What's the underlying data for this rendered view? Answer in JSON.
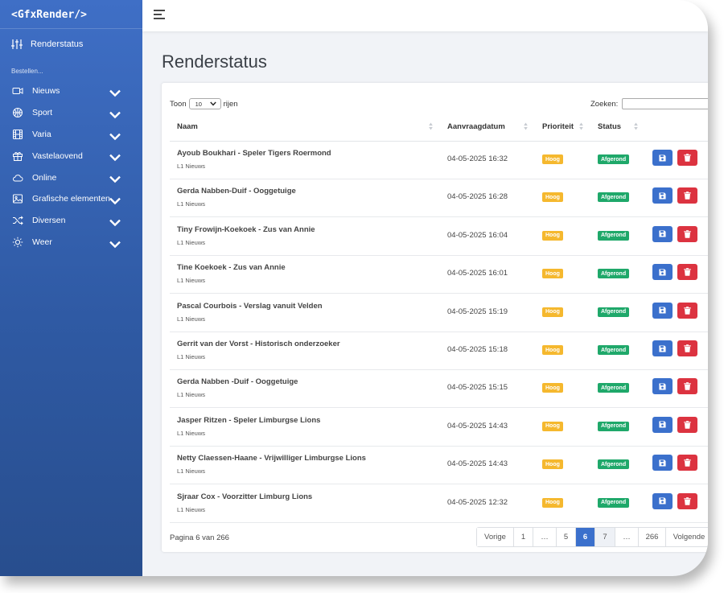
{
  "brand": "<GfxRender/>",
  "sidebar": {
    "main_item": "Renderstatus",
    "section_label": "Bestellen...",
    "items": [
      {
        "label": "Nieuws",
        "icon": "video-camera-icon"
      },
      {
        "label": "Sport",
        "icon": "ball-icon"
      },
      {
        "label": "Varia",
        "icon": "film-icon"
      },
      {
        "label": "Vastelaovend",
        "icon": "gift-icon"
      },
      {
        "label": "Online",
        "icon": "cloud-icon"
      },
      {
        "label": "Grafische elementen",
        "icon": "image-icon"
      },
      {
        "label": "Diversen",
        "icon": "shuffle-icon"
      },
      {
        "label": "Weer",
        "icon": "sun-icon"
      }
    ]
  },
  "page": {
    "title": "Renderstatus"
  },
  "table_controls": {
    "show_prefix": "Toon",
    "show_value": "10",
    "show_suffix": "rijen",
    "search_label": "Zoeken:"
  },
  "columns": {
    "naam": "Naam",
    "datum": "Aanvraagdatum",
    "prioriteit": "Prioriteit",
    "status": "Status"
  },
  "rows": [
    {
      "title": "Ayoub Boukhari - Speler Tigers Roermond",
      "category": "L1 Nieuws",
      "date": "04-05-2025 16:32",
      "priority": "Hoog",
      "status": "Afgerond"
    },
    {
      "title": "Gerda Nabben-Duif - Ooggetuige",
      "category": "L1 Nieuws",
      "date": "04-05-2025 16:28",
      "priority": "Hoog",
      "status": "Afgerond"
    },
    {
      "title": "Tiny Frowijn-Koekoek - Zus van Annie",
      "category": "L1 Nieuws",
      "date": "04-05-2025 16:04",
      "priority": "Hoog",
      "status": "Afgerond"
    },
    {
      "title": "Tine Koekoek - Zus van Annie",
      "category": "L1 Nieuws",
      "date": "04-05-2025 16:01",
      "priority": "Hoog",
      "status": "Afgerond"
    },
    {
      "title": "Pascal Courbois - Verslag vanuit Velden",
      "category": "L1 Nieuws",
      "date": "04-05-2025 15:19",
      "priority": "Hoog",
      "status": "Afgerond"
    },
    {
      "title": "Gerrit van der Vorst - Historisch onderzoeker",
      "category": "L1 Nieuws",
      "date": "04-05-2025 15:18",
      "priority": "Hoog",
      "status": "Afgerond"
    },
    {
      "title": "Gerda Nabben -Duif - Ooggetuige",
      "category": "L1 Nieuws",
      "date": "04-05-2025 15:15",
      "priority": "Hoog",
      "status": "Afgerond"
    },
    {
      "title": "Jasper Ritzen - Speler Limburgse Lions",
      "category": "L1 Nieuws",
      "date": "04-05-2025 14:43",
      "priority": "Hoog",
      "status": "Afgerond"
    },
    {
      "title": "Netty Claessen-Haane - Vrijwilliger Limburgse Lions",
      "category": "L1 Nieuws",
      "date": "04-05-2025 14:43",
      "priority": "Hoog",
      "status": "Afgerond"
    },
    {
      "title": "Sjraar Cox - Voorzitter Limburg Lions",
      "category": "L1 Nieuws",
      "date": "04-05-2025 12:32",
      "priority": "Hoog",
      "status": "Afgerond"
    }
  ],
  "footer": {
    "info": "Pagina 6 van 266"
  },
  "pagination": [
    {
      "label": "Vorige",
      "state": "normal"
    },
    {
      "label": "1",
      "state": "normal"
    },
    {
      "label": "…",
      "state": "normal"
    },
    {
      "label": "5",
      "state": "normal"
    },
    {
      "label": "6",
      "state": "active"
    },
    {
      "label": "7",
      "state": "hover"
    },
    {
      "label": "…",
      "state": "normal"
    },
    {
      "label": "266",
      "state": "normal"
    },
    {
      "label": "Volgende",
      "state": "normal"
    }
  ],
  "colors": {
    "sidebar_top": "#3f6fc6",
    "sidebar_bottom": "#284e8e",
    "primary": "#3b70cc",
    "danger": "#dc3340",
    "warning": "#f5b82e",
    "success": "#1fa86a"
  }
}
